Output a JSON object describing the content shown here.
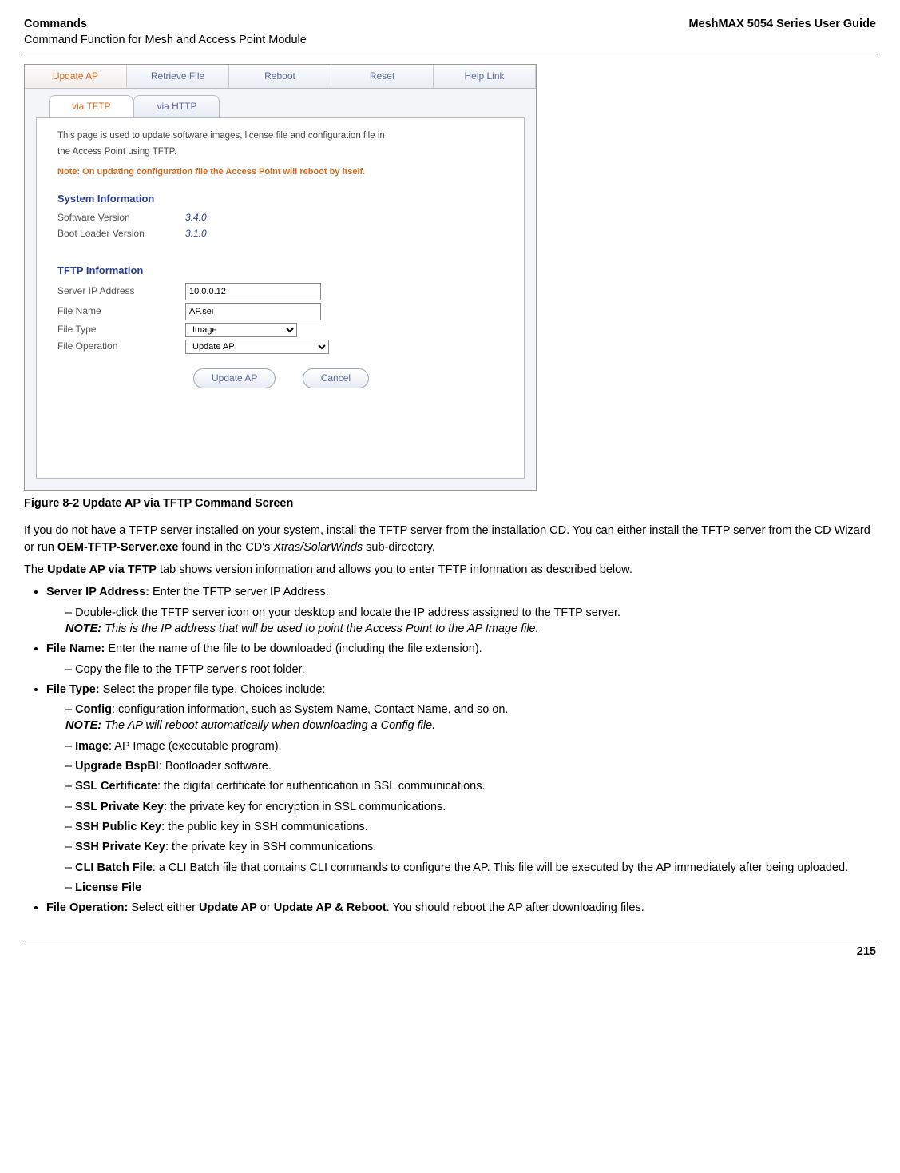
{
  "header": {
    "left_title": "Commands",
    "left_sub": "Command Function for Mesh and Access Point Module",
    "right_title": "MeshMAX 5054 Series User Guide"
  },
  "screenshot": {
    "top_tabs": [
      "Update AP",
      "Retrieve File",
      "Reboot",
      "Reset",
      "Help Link"
    ],
    "sub_tabs": [
      "via TFTP",
      "via HTTP"
    ],
    "desc1": "This page is used to update software images, license file and configuration file in",
    "desc2": "the Access Point using TFTP.",
    "warn": "Note: On updating configuration file the Access Point will reboot by itself.",
    "section_sysinfo": "System Information",
    "sw_version_label": "Software Version",
    "sw_version": "3.4.0",
    "bl_version_label": "Boot Loader Version",
    "bl_version": "3.1.0",
    "section_tftp": "TFTP Information",
    "server_ip_label": "Server IP Address",
    "server_ip": "10.0.0.12",
    "file_name_label": "File Name",
    "file_name": "AP.sei",
    "file_type_label": "File Type",
    "file_type": "Image",
    "file_op_label": "File Operation",
    "file_op": "Update AP",
    "btn_update": "Update AP",
    "btn_cancel": "Cancel"
  },
  "caption": "Figure 8-2 Update AP via TFTP Command Screen",
  "body": {
    "p1a": "If you do not have a TFTP server installed on your system, install the TFTP server from the installation CD. You can either install the TFTP server from the CD Wizard or run ",
    "p1b": "OEM-TFTP-Server.exe",
    "p1c": " found in the CD's ",
    "p1d": "Xtras/SolarWinds",
    "p1e": " sub-directory.",
    "p2a": "The ",
    "p2b": "Update AP via TFTP",
    "p2c": " tab shows version information and allows you to enter TFTP information as described below.",
    "li1_label": "Server IP Address:",
    "li1_text": " Enter the TFTP server IP Address.",
    "li1_sub": "Double-click the TFTP server icon on your desktop and locate the IP address assigned to the TFTP server.",
    "li1_note_label": "NOTE:",
    "li1_note": " This is the IP address that will be used to point the Access Point to the AP Image file.",
    "li2_label": "File Name:",
    "li2_text": " Enter the name of the file to be downloaded (including the file extension).",
    "li2_sub": "Copy the file to the TFTP server's root folder.",
    "li3_label": "File Type:",
    "li3_text": " Select the proper file type. Choices include:",
    "li3_config_b": "Config",
    "li3_config_t": ": configuration information, such as System Name, Contact Name, and so on.",
    "li3_config_note_label": "NOTE:",
    "li3_config_note": " The AP will reboot automatically when downloading a Config file.",
    "li3_image_b": "Image",
    "li3_image_t": ": AP Image (executable program).",
    "li3_bspbl_b": "Upgrade BspBl",
    "li3_bspbl_t": ": Bootloader software.",
    "li3_sslcert_b": "SSL Certificate",
    "li3_sslcert_t": ": the digital certificate for authentication in SSL communications.",
    "li3_sslpk_b": "SSL Private Key",
    "li3_sslpk_t": ": the private key for encryption in SSL communications.",
    "li3_sshpub_b": "SSH Public Key",
    "li3_sshpub_t": ": the public key in SSH communications.",
    "li3_sshpriv_b": "SSH Private Key",
    "li3_sshpriv_t": ": the private key in SSH communications.",
    "li3_cli_b": "CLI Batch File",
    "li3_cli_t": ": a CLI Batch file that contains CLI commands to configure the AP. This file will be executed by the AP immediately after being uploaded.",
    "li3_license": "License File",
    "li4_label": "File Operation:",
    "li4_text_a": " Select either ",
    "li4_text_b": "Update AP",
    "li4_text_c": " or ",
    "li4_text_d": "Update AP & Reboot",
    "li4_text_e": ". You should reboot the AP after downloading files."
  },
  "page_number": "215"
}
